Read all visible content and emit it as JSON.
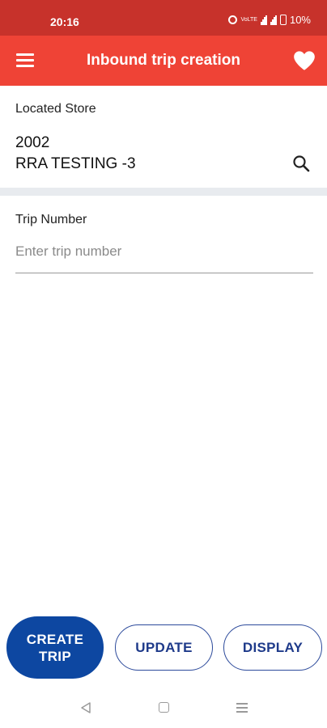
{
  "status_bar": {
    "time": "20:16",
    "network_label": "VoLTE",
    "battery": "10%"
  },
  "app_bar": {
    "title": "Inbound trip creation",
    "menu_icon": "hamburger-menu-icon",
    "favorite_icon": "heart-icon",
    "color": "#ef4336"
  },
  "store": {
    "label": "Located Store",
    "code": "2002",
    "name": "RRA TESTING -3",
    "search_icon": "search-icon"
  },
  "trip": {
    "label": "Trip Number",
    "value": "",
    "placeholder": "Enter trip number"
  },
  "actions": {
    "create_label": "CREATE TRIP",
    "update_label": "UPDATE",
    "display_label": "DISPLAY",
    "primary_color": "#0d47a1"
  },
  "nav": {
    "back_icon": "triangle-back-icon",
    "home_icon": "square-home-icon",
    "recent_icon": "menu-lines-icon"
  }
}
